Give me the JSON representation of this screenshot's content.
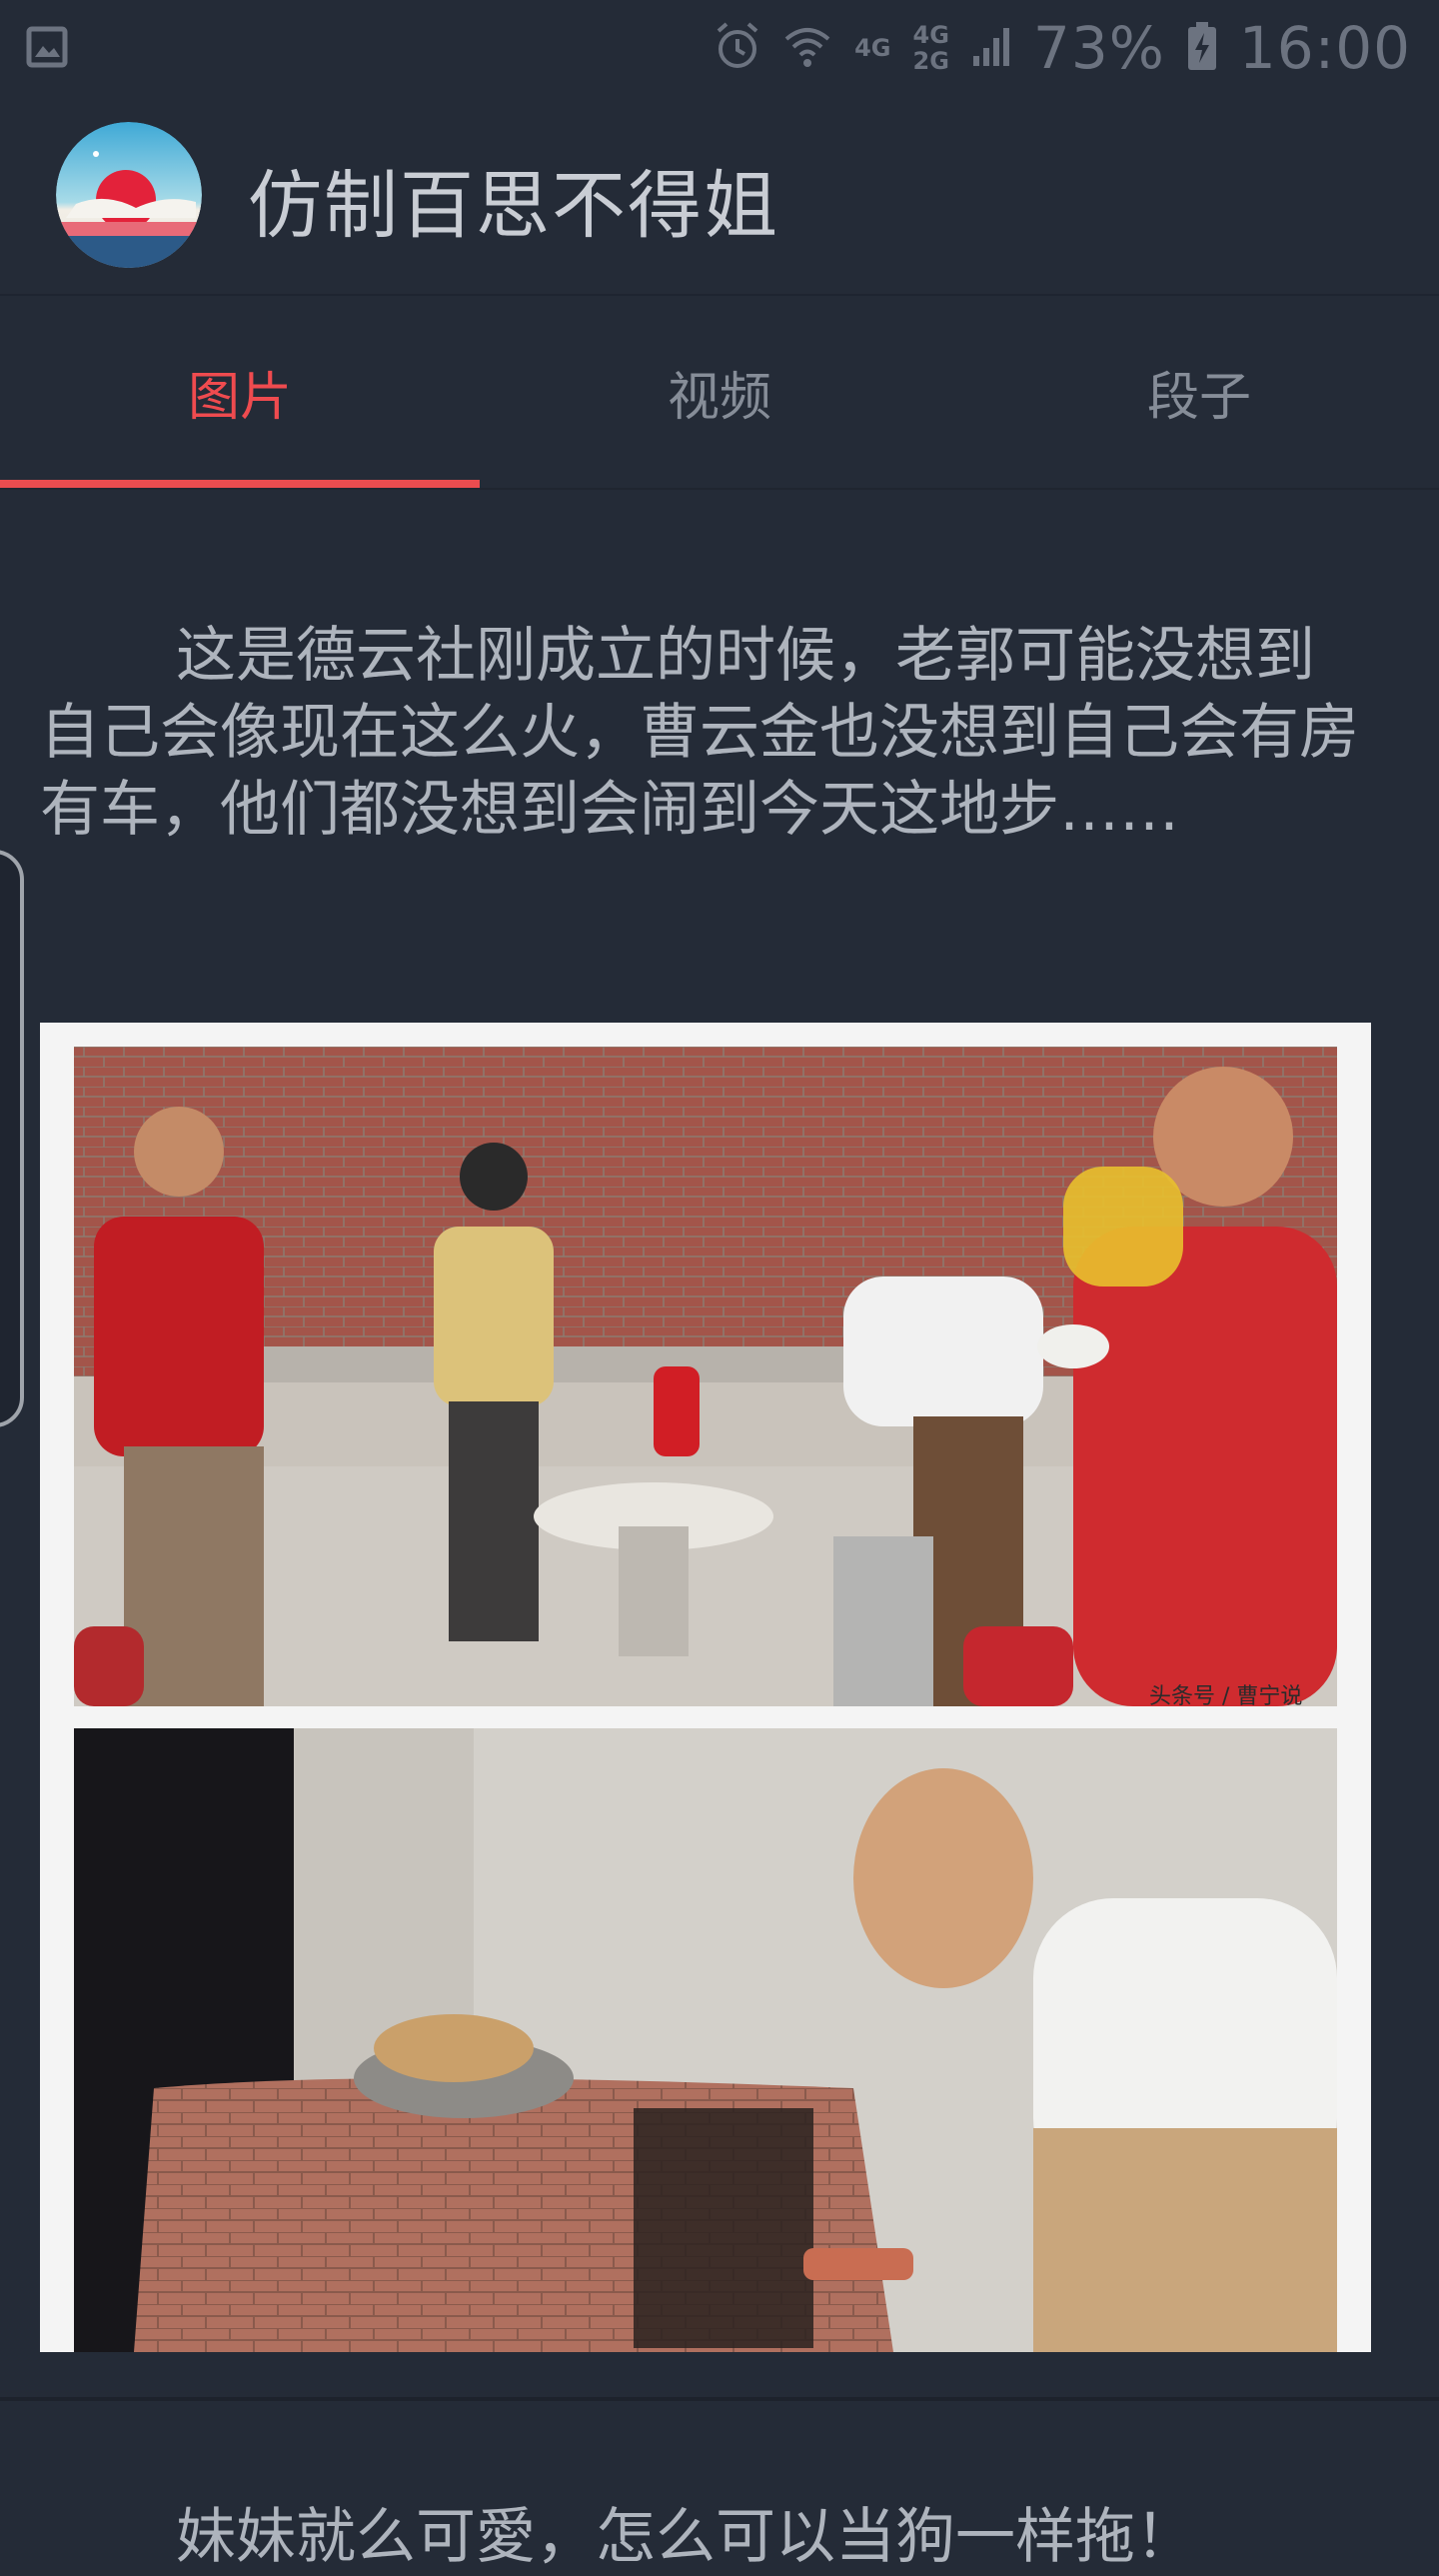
{
  "status_bar": {
    "left_icon": "image-notification-icon",
    "alarm_icon": "alarm-icon",
    "wifi_icon": "wifi-icon",
    "net1_label": "4G",
    "net2_label_top": "4G",
    "net2_label_bottom": "2G",
    "signal_icon": "signal-icon",
    "battery_percent": "73%",
    "battery_icon": "battery-charging-icon",
    "time": "16:00"
  },
  "app_bar": {
    "logo_icon": "app-logo-icon",
    "title": "仿制百思不得姐"
  },
  "tabs": [
    {
      "label": "图片",
      "active": true
    },
    {
      "label": "视频",
      "active": false
    },
    {
      "label": "段子",
      "active": false
    }
  ],
  "colors": {
    "background": "#242b37",
    "accent": "#ef4b4f",
    "text": "#aeb4bd"
  },
  "feed": {
    "post1": {
      "text": "这是德云社刚成立的时候，老郭可能没想到自己会像现在这么火，曹云金也没想到自己会有房有车，他们都没想到会闹到今天这地步……",
      "image_caption": "头条号 / 曹宁说"
    },
    "post2": {
      "text": "妹妹就么可愛，怎么可以当狗一样拖！"
    }
  }
}
